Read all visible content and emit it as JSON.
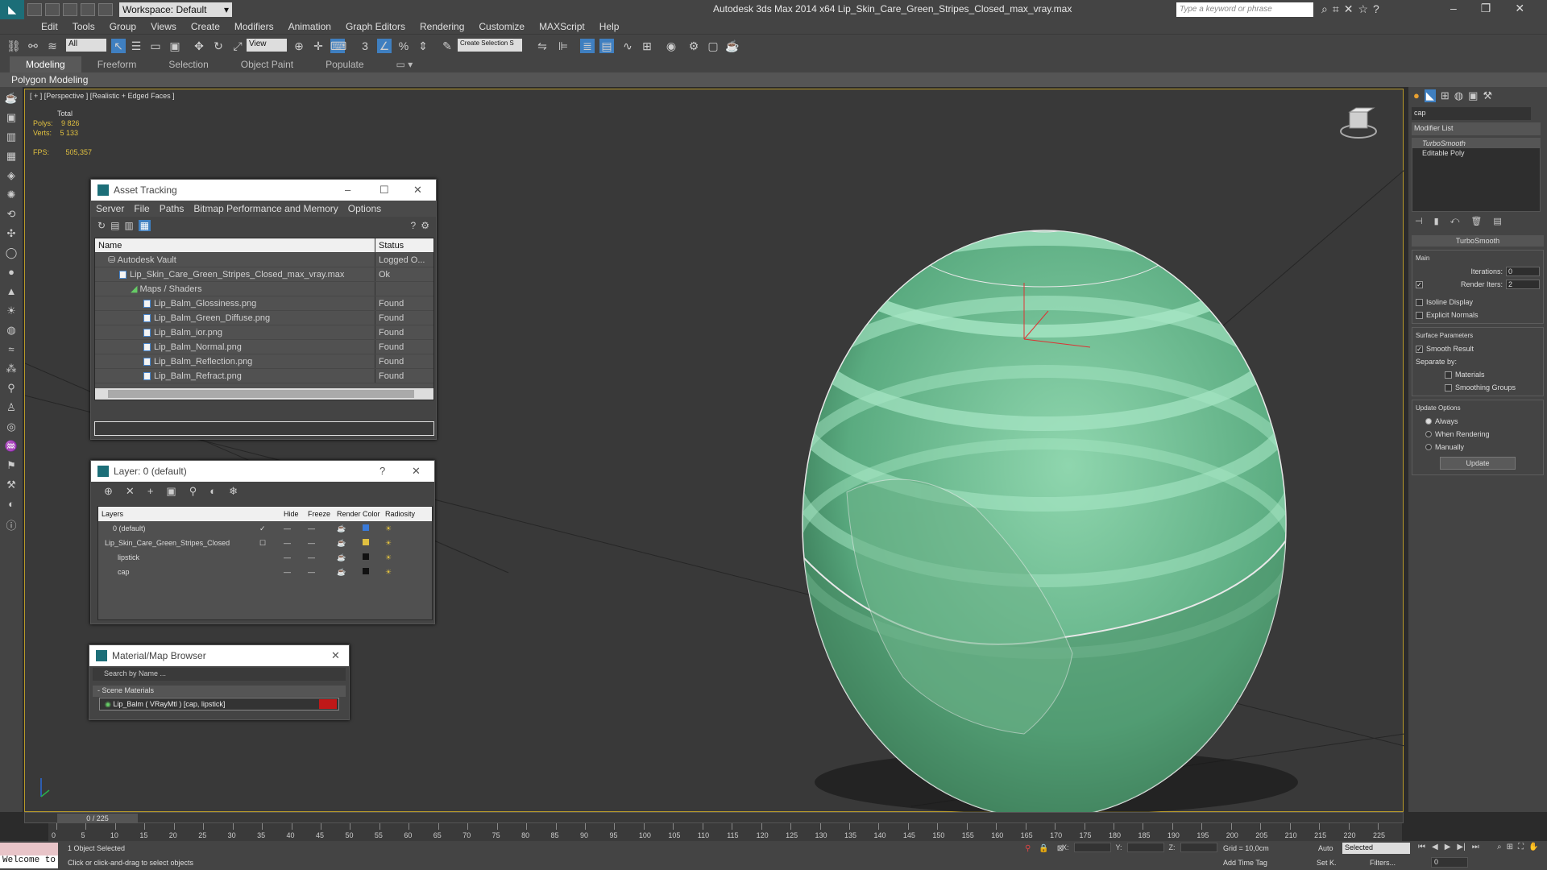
{
  "app": {
    "workspace": "Workspace: Default",
    "title": "Autodesk 3ds Max  2014 x64    Lip_Skin_Care_Green_Stripes_Closed_max_vray.max",
    "search_placeholder": "Type a keyword or phrase"
  },
  "menu": [
    "Edit",
    "Tools",
    "Group",
    "Views",
    "Create",
    "Modifiers",
    "Animation",
    "Graph Editors",
    "Rendering",
    "Customize",
    "MAXScript",
    "Help"
  ],
  "toolbar": {
    "filter_select": "All",
    "view_select": "View",
    "named_selection": "Create Selection S"
  },
  "ribbon": {
    "tabs": [
      "Modeling",
      "Freeform",
      "Selection",
      "Object Paint",
      "Populate"
    ],
    "sub": "Polygon Modeling"
  },
  "viewport": {
    "label": "[ + ] [Perspective ] [Realistic + Edged Faces ]",
    "total": "Total",
    "polys_label": "Polys:",
    "polys": "9 826",
    "verts_label": "Verts:",
    "verts": "5 133",
    "fps_label": "FPS:",
    "fps": "505,357"
  },
  "asset_tracking": {
    "title": "Asset Tracking",
    "menu": [
      "Server",
      "File",
      "Paths",
      "Bitmap Performance and Memory",
      "Options"
    ],
    "col_name": "Name",
    "col_status": "Status",
    "rows": [
      {
        "name": "Autodesk Vault",
        "status": "Logged O..."
      },
      {
        "name": "Lip_Skin_Care_Green_Stripes_Closed_max_vray.max",
        "status": "Ok"
      },
      {
        "name": "Maps / Shaders",
        "status": ""
      },
      {
        "name": "Lip_Balm_Glossiness.png",
        "status": "Found"
      },
      {
        "name": "Lip_Balm_Green_Diffuse.png",
        "status": "Found"
      },
      {
        "name": "Lip_Balm_ior.png",
        "status": "Found"
      },
      {
        "name": "Lip_Balm_Normal.png",
        "status": "Found"
      },
      {
        "name": "Lip_Balm_Reflection.png",
        "status": "Found"
      },
      {
        "name": "Lip_Balm_Refract.png",
        "status": "Found"
      }
    ]
  },
  "layers": {
    "title": "Layer: 0 (default)",
    "help": "?",
    "cols": [
      "Layers",
      "Hide",
      "Freeze",
      "Render",
      "Color",
      "Radiosity"
    ],
    "rows": [
      {
        "name": "0 (default)",
        "color": "#3a7ad8"
      },
      {
        "name": "Lip_Skin_Care_Green_Stripes_Closed",
        "color": "#e0c040"
      },
      {
        "name": "lipstick",
        "color": "#111111"
      },
      {
        "name": "cap",
        "color": "#111111"
      }
    ]
  },
  "material_browser": {
    "title": "Material/Map Browser",
    "search_placeholder": "Search by Name ...",
    "group": "- Scene Materials",
    "item": "Lip_Balm  ( VRayMtl ) [cap, lipstick]"
  },
  "command_panel": {
    "name_field": "cap",
    "modifier_list": "Modifier List",
    "stack": [
      "TurboSmooth",
      "Editable Poly"
    ],
    "rollout": "TurboSmooth",
    "main": "Main",
    "iterations_label": "Iterations:",
    "iterations": "0",
    "render_iters_label": "Render Iters:",
    "render_iters": "2",
    "isoline": "Isoline Display",
    "explicit": "Explicit Normals",
    "surface": "Surface Parameters",
    "smooth_result": "Smooth Result",
    "separate_by": "Separate by:",
    "materials": "Materials",
    "smoothing_groups": "Smoothing Groups",
    "update_options": "Update Options",
    "always": "Always",
    "when_rendering": "When Rendering",
    "manually": "Manually",
    "update": "Update"
  },
  "timeline": {
    "frame": "0 / 225",
    "ticks": [
      "0",
      "5",
      "10",
      "15",
      "20",
      "25",
      "30",
      "35",
      "40",
      "45",
      "50",
      "55",
      "60",
      "65",
      "70",
      "75",
      "80",
      "85",
      "90",
      "95",
      "100",
      "105",
      "110",
      "115",
      "120",
      "125",
      "130",
      "135",
      "140",
      "145",
      "150",
      "155",
      "160",
      "165",
      "170",
      "175",
      "180",
      "185",
      "190",
      "195",
      "200",
      "205",
      "210",
      "215",
      "220",
      "225"
    ]
  },
  "status": {
    "welcome": "Welcome to",
    "selected": "1 Object Selected",
    "hint": "Click or click-and-drag to select objects",
    "grid": "Grid = 10,0cm",
    "add_time_tag": "Add Time Tag",
    "auto": "Auto",
    "set_key": "Set K.",
    "selected_dd": "Selected",
    "filters": "Filters...",
    "frame": "0"
  }
}
